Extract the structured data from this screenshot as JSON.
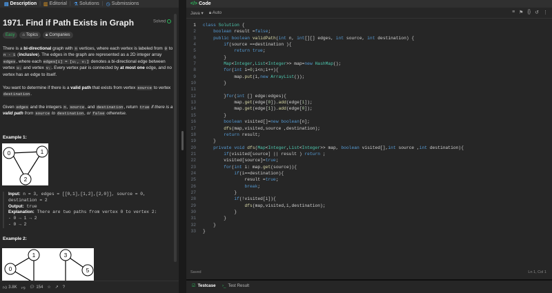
{
  "left_tabs": [
    {
      "label": "Description",
      "icon": "doc-icon"
    },
    {
      "label": "Editorial",
      "icon": "book-icon"
    },
    {
      "label": "Solutions",
      "icon": "flask-icon"
    },
    {
      "label": "Submissions",
      "icon": "clock-icon"
    }
  ],
  "problem": {
    "title": "1971. Find if Path Exists in Graph",
    "status": "Solved",
    "difficulty": "Easy",
    "topics": "Topics",
    "companies": "Companies",
    "p1_a": "There is a ",
    "p1_b": "bi-directional",
    "p1_c": " graph with ",
    "p1_n": "n",
    "p1_d": " vertices, where each vertex is labeled from ",
    "p1_0": "0",
    "p1_e": " to ",
    "p1_n1": "n - 1",
    "p1_f": " (",
    "p1_g": "inclusive",
    "p1_h": "). The edges in the graph are represented as a 2D integer array ",
    "p1_edges": "edges",
    "p1_i": ", where each ",
    "p1_edgesi": "edges[i] = [uᵢ, vᵢ]",
    "p1_j": " denotes a bi-directional edge between vertex ",
    "p1_ui": "uᵢ",
    "p1_k": " and vertex ",
    "p1_vi": "vᵢ",
    "p1_l": ". Every vertex pair is connected by ",
    "p1_m": "at most one",
    "p1_o": " edge, and no vertex has an edge to itself.",
    "p2_a": "You want to determine if there is a ",
    "p2_b": "valid path",
    "p2_c": " that exists from vertex ",
    "p2_src": "source",
    "p2_d": " to vertex ",
    "p2_dst": "destination",
    "p2_e": ".",
    "p3_a": "Given ",
    "p3_edges": "edges",
    "p3_b": " and the integers ",
    "p3_n": "n",
    "p3_c": ", ",
    "p3_src": "source",
    "p3_d": ", and ",
    "p3_dst": "destination",
    "p3_e": ", return ",
    "p3_true": "true",
    "p3_f": " if there is a ",
    "p3_g": "valid path",
    "p3_h": " from ",
    "p3_src2": "source",
    "p3_i": " to ",
    "p3_dst2": "destination",
    "p3_j": ", or ",
    "p3_false": "false",
    "p3_k": " otherwise."
  },
  "example1": {
    "title": "Example 1:",
    "nodes": [
      "0",
      "1",
      "2"
    ],
    "input_label": "Input:",
    "input_val": " n = 3, edges = [[0,1],[1,2],[2,0]], source = 0,",
    "input_val2": "destination = 2",
    "output_label": "Output:",
    "output_val": " true",
    "expl_label": "Explanation:",
    "expl_val": " There are two paths from vertex 0 to vertex 2:",
    "expl_l1": "- 0 → 1 → 2",
    "expl_l2": "- 0 → 2"
  },
  "example2": {
    "title": "Example 2:",
    "nodes": [
      "0",
      "1",
      "3",
      "5"
    ]
  },
  "footer": {
    "likes": "3.8K",
    "comments": "154"
  },
  "editor": {
    "tab": "Code",
    "language": "Java",
    "mode": "Auto",
    "status": "Saved",
    "cursor": "Ln 1, Col 1"
  },
  "bottom_tabs": [
    "Testcase",
    "Test Result"
  ],
  "code_lines": [
    "class Solution {",
    "    boolean result =false;",
    "    public boolean validPath(int n, int[][] edges, int source, int destination) {",
    "        if(source ==destination ){",
    "            return true;",
    "        }",
    "        Map<Integer,List<Integer>> map=new HashMap();",
    "        for(int i=0;i<n;i++){",
    "            map.put(i,new ArrayList());",
    "        }",
    "",
    "        }for(int [] edge:edges){",
    "            map.get(edge[0]).add(edge[1]);",
    "            map.get(edge[1]).add(edge[0]);",
    "        }",
    "        boolean visited[]=new boolean[n];",
    "        dfs(map,visited,source ,destination);",
    "        return result;",
    "    }",
    "    private void dfs(Map<Integer,List<Integer>> map, boolean visited[],int source ,int destination){",
    "        if(visited[source] || result ) return ;",
    "        visited[source]=true;",
    "        for(int i: map.get(source)){",
    "            if(i==destination){",
    "                result =true;",
    "                break;",
    "            }",
    "            if(!visited[i]){",
    "                dfs(map,visited,i,destination);",
    "            }",
    "        }",
    "    }",
    "}"
  ]
}
